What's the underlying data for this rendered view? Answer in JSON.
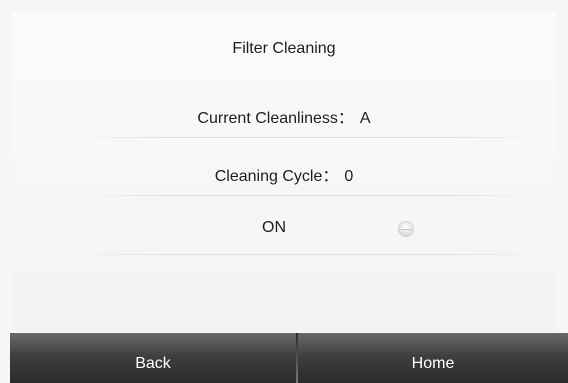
{
  "screen": {
    "title": "Filter Cleaning"
  },
  "info": {
    "cleanliness_label": "Current Cleanliness：",
    "cleanliness_value": "A",
    "cycle_label": "Cleaning Cycle：",
    "cycle_value": "0"
  },
  "toggle": {
    "label": "ON",
    "state": "off"
  },
  "nav": {
    "back_label": "Back",
    "home_label": "Home"
  }
}
